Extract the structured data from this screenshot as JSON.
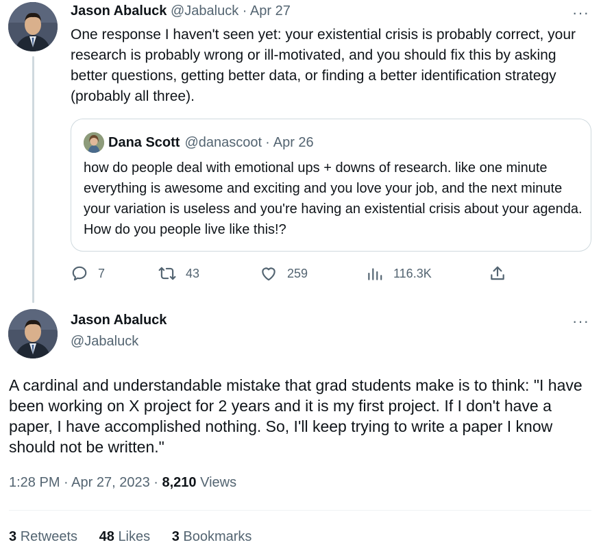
{
  "tweet1": {
    "author_name": "Jason Abaluck",
    "author_handle": "@Jabaluck",
    "date": "Apr 27",
    "body": "One response I haven't seen yet: your existential crisis is probably correct, your research is probably wrong or ill-motivated, and you should fix this by asking better questions, getting better data, or finding a better identification strategy (probably all three).",
    "quote": {
      "author_name": "Dana Scott",
      "author_handle": "@danascoot",
      "date": "Apr 26",
      "body": "how do people deal with emotional ups + downs of research. like one minute everything is awesome and exciting and you love your job, and the next minute your variation is useless and you're having an existential crisis about your agenda. How do you people live like this!?"
    },
    "actions": {
      "replies": "7",
      "retweets": "43",
      "likes": "259",
      "views": "116.3K"
    }
  },
  "tweet2": {
    "author_name": "Jason Abaluck",
    "author_handle": "@Jabaluck",
    "body": "A cardinal and understandable mistake that grad students make is to think: \"I have been working on X project for 2 years and it is my first project. If I don't have a paper, I have accomplished nothing. So, I'll keep trying to write a paper I know should not be written.\"",
    "time": "1:28 PM",
    "full_date": "Apr 27, 2023",
    "views_count": "8,210",
    "views_label": "Views",
    "retweets_count": "3",
    "retweets_label": "Retweets",
    "likes_count": "48",
    "likes_label": "Likes",
    "bookmarks_count": "3",
    "bookmarks_label": "Bookmarks"
  },
  "ui": {
    "separator": "·",
    "more_glyph": "···",
    "accent_color": "#1d9bf0",
    "muted_color": "#536471",
    "icons": [
      "reply-icon",
      "retweet-icon",
      "like-icon",
      "views-icon",
      "share-icon",
      "more-icon"
    ]
  }
}
